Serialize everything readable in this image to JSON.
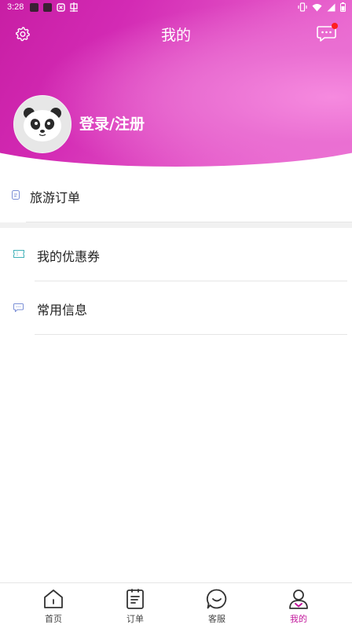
{
  "status_bar": {
    "time": "3:28"
  },
  "header": {
    "title": "我的"
  },
  "profile": {
    "login_label": "登录/注册"
  },
  "menu": {
    "travel_orders": "旅游订单",
    "coupons": "我的优惠券",
    "common_info": "常用信息"
  },
  "tabbar": {
    "items": [
      {
        "label": "首页",
        "icon": "home-icon"
      },
      {
        "label": "订单",
        "icon": "order-icon"
      },
      {
        "label": "客服",
        "icon": "customer-service-icon"
      },
      {
        "label": "我的",
        "icon": "profile-icon"
      }
    ],
    "active_index": 3
  },
  "colors": {
    "accent": "#c2189c",
    "header_light": "#f384dd",
    "badge": "#ff1e1e"
  }
}
